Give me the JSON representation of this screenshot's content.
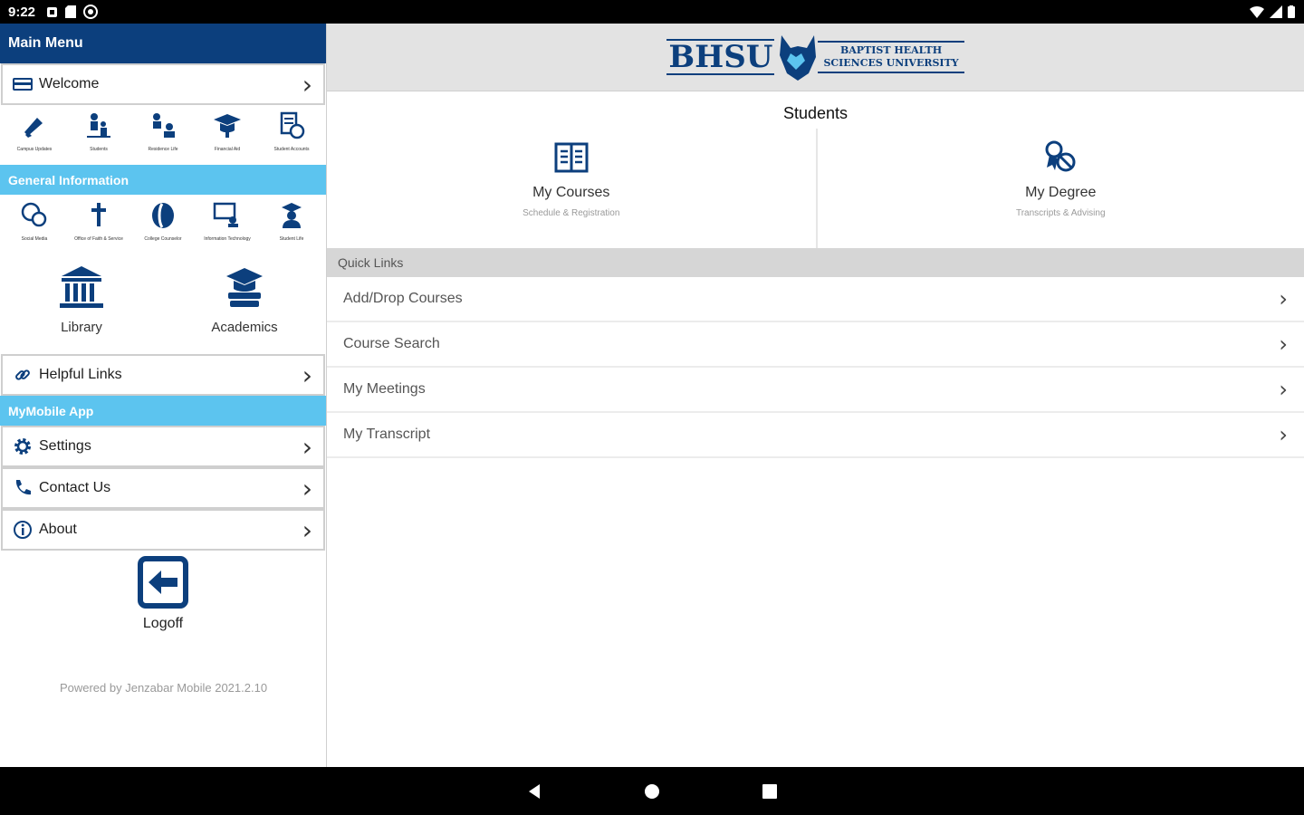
{
  "status": {
    "time": "9:22"
  },
  "sidebar": {
    "main_menu": "Main Menu",
    "welcome": "Welcome",
    "top_grid": [
      {
        "label": "Campus Updates",
        "icon": "megaphone-icon"
      },
      {
        "label": "Students",
        "icon": "students-icon"
      },
      {
        "label": "Residence Life",
        "icon": "residence-life-icon"
      },
      {
        "label": "Financial Aid",
        "icon": "graduation-cap-icon"
      },
      {
        "label": "Student Accounts",
        "icon": "student-accounts-icon"
      }
    ],
    "general_info": "General Information",
    "gen_grid": [
      {
        "label": "Social Media",
        "icon": "social-media-icon"
      },
      {
        "label": "Office of Faith & Service",
        "icon": "cross-icon"
      },
      {
        "label": "College Counselor",
        "icon": "counselor-icon"
      },
      {
        "label": "Information Technology",
        "icon": "it-icon"
      },
      {
        "label": "Student Life",
        "icon": "student-life-icon"
      }
    ],
    "library": "Library",
    "academics": "Academics",
    "helpful_links": "Helpful Links",
    "mymobile": "MyMobile App",
    "settings": "Settings",
    "contact": "Contact Us",
    "about": "About",
    "logoff": "Logoff",
    "powered": "Powered by Jenzabar Mobile 2021.2.10"
  },
  "header": {
    "logo_abbr": "BHSU",
    "logo_line1": "BAPTIST HEALTH",
    "logo_line2": "SCIENCES UNIVERSITY"
  },
  "main": {
    "title": "Students",
    "tiles": [
      {
        "title": "My Courses",
        "sub": "Schedule & Registration"
      },
      {
        "title": "My Degree",
        "sub": "Transcripts & Advising"
      }
    ],
    "quick_links_label": "Quick Links",
    "quick_links": [
      "Add/Drop Courses",
      "Course Search",
      "My Meetings",
      "My Transcript"
    ]
  },
  "colors": {
    "brand_navy": "#0c3f7d",
    "brand_light": "#5cc4ef"
  }
}
